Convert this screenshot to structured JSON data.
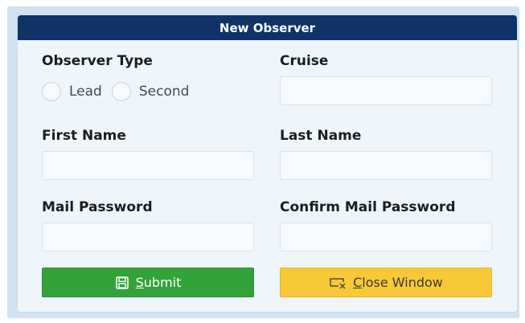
{
  "window": {
    "title": "New Observer"
  },
  "form": {
    "observer_type": {
      "label": "Observer Type",
      "options": [
        "Lead",
        "Second"
      ]
    },
    "cruise": {
      "label": "Cruise",
      "value": ""
    },
    "first_name": {
      "label": "First Name",
      "value": ""
    },
    "last_name": {
      "label": "Last Name",
      "value": ""
    },
    "mail_password": {
      "label": "Mail Password",
      "value": ""
    },
    "confirm_mail_password": {
      "label": "Confirm Mail Password",
      "value": ""
    }
  },
  "buttons": {
    "submit": {
      "label": "Submit",
      "icon": "save-icon",
      "color": "#33a23b"
    },
    "close": {
      "label": "Close Window",
      "icon": "close-window-icon",
      "color": "#f7c936"
    }
  },
  "colors": {
    "titlebar": "#0f3366",
    "dialog_background": "#eef6fc",
    "frame": "#cfe3f3"
  }
}
